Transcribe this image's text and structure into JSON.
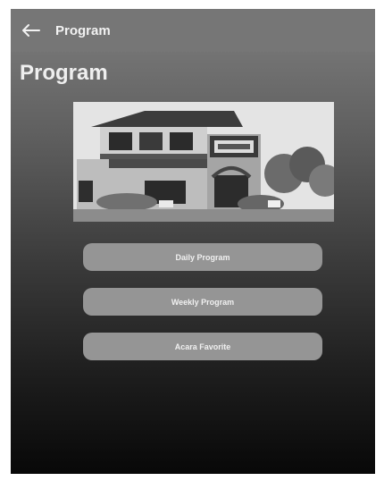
{
  "appbar": {
    "back_icon": "arrow-left-icon",
    "title": "Program"
  },
  "page": {
    "heading": "Program"
  },
  "photo": {
    "subject": "building-photo"
  },
  "menu": {
    "items": [
      {
        "label": "Daily Program"
      },
      {
        "label": "Weekly Program"
      },
      {
        "label": "Acara Favorite"
      }
    ]
  },
  "colors": {
    "appbar_bg": "#767676",
    "button_bg": "#959595",
    "text": "#f0f0f0"
  }
}
